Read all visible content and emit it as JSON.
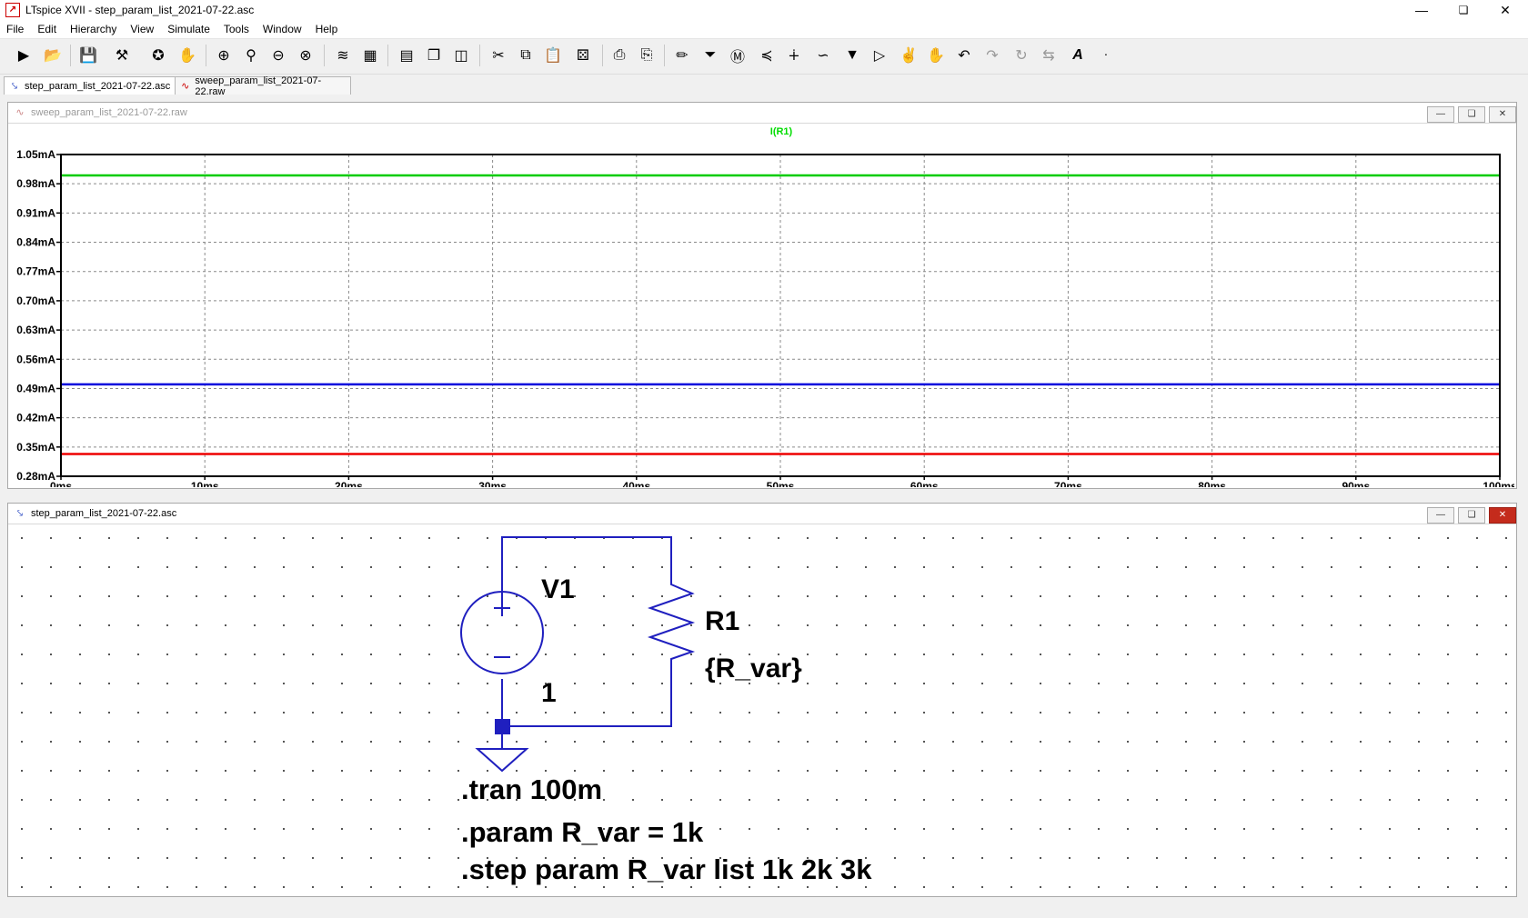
{
  "window": {
    "title": "LTspice XVII - step_param_list_2021-07-22.asc"
  },
  "menu": [
    "File",
    "Edit",
    "Hierarchy",
    "View",
    "Simulate",
    "Tools",
    "Window",
    "Help"
  ],
  "toolbar": {
    "icons": [
      "run-icon",
      "open-icon",
      "save-icon",
      "control-panel-icon",
      "halt-icon",
      "pan-icon",
      "zoom-in-icon",
      "zoom-area-icon",
      "zoom-out-icon",
      "zoom-fit-icon",
      "autorange-icon",
      "grid-icon",
      "tile-horizontal-icon",
      "cascade-icon",
      "tile-vertical-icon",
      "cut-icon",
      "copy-icon",
      "paste-icon",
      "find-icon",
      "print-icon",
      "print-setup-icon",
      "wire-icon",
      "ground-icon",
      "label-icon",
      "resistor-icon",
      "capacitor-icon",
      "inductor-icon",
      "diode-icon",
      "component-icon",
      "move-icon",
      "drag-icon",
      "undo-icon",
      "redo-icon",
      "rotate-icon",
      "mirror-icon",
      "text-icon",
      "spice-directive-icon"
    ]
  },
  "tabs": [
    {
      "label": "step_param_list_2021-07-22.asc",
      "icon": "schematic-icon"
    },
    {
      "label": "sweep_param_list_2021-07-22.raw",
      "icon": "waveform-icon"
    }
  ],
  "waveform_window": {
    "title": "sweep_param_list_2021-07-22.raw",
    "trace_label": "I(R1)",
    "trace_label_color": "#00dd00"
  },
  "schematic_window": {
    "title": "step_param_list_2021-07-22.asc",
    "source_name": "V1",
    "source_value": "1",
    "resistor_name": "R1",
    "resistor_value": "{R_var}",
    "directives": [
      ".tran 100m",
      ".param R_var = 1k",
      ".step param R_var list 1k 2k 3k"
    ],
    "wire_color": "#1f1fbf"
  },
  "chart_data": {
    "type": "line",
    "title": "I(R1)",
    "xlabel": "",
    "ylabel": "",
    "xlim": [
      0,
      100
    ],
    "ylim": [
      0.28,
      1.05
    ],
    "x_ticks": [
      "0ms",
      "10ms",
      "20ms",
      "30ms",
      "40ms",
      "50ms",
      "60ms",
      "70ms",
      "80ms",
      "90ms",
      "100ms"
    ],
    "y_ticks": [
      "1.05mA",
      "0.98mA",
      "0.91mA",
      "0.84mA",
      "0.77mA",
      "0.70mA",
      "0.63mA",
      "0.56mA",
      "0.49mA",
      "0.42mA",
      "0.35mA",
      "0.28mA"
    ],
    "grid": true,
    "series": [
      {
        "color": "#00cc00",
        "x": [
          0,
          100
        ],
        "y": [
          1.0,
          1.0
        ]
      },
      {
        "color": "#0000dd",
        "x": [
          0,
          100
        ],
        "y": [
          0.5,
          0.5
        ]
      },
      {
        "color": "#ee0000",
        "x": [
          0,
          100
        ],
        "y": [
          0.3333,
          0.3333
        ]
      }
    ]
  }
}
